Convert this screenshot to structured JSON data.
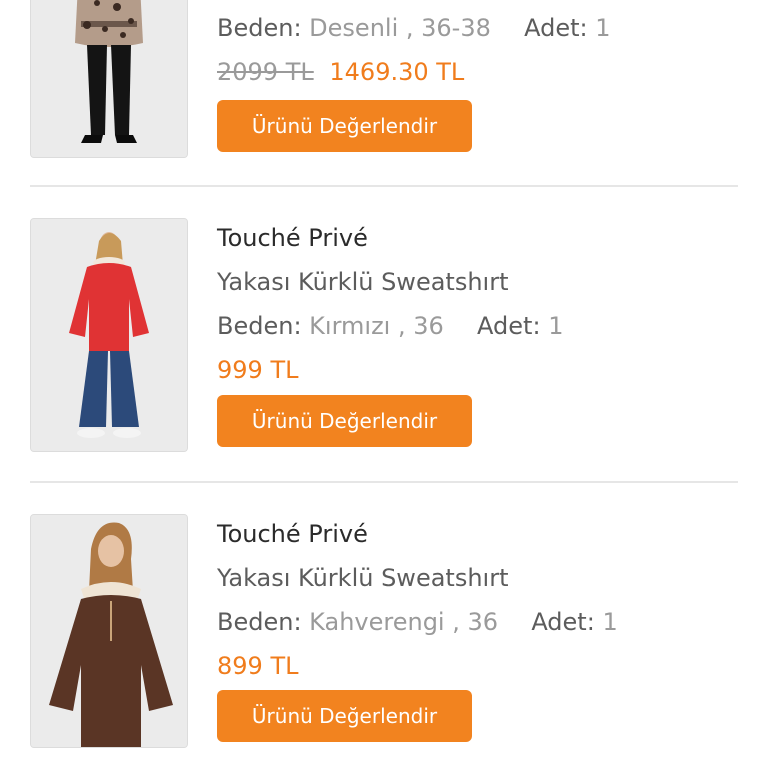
{
  "orders": [
    {
      "brand": "",
      "name": "",
      "size_label": "Beden:",
      "size_value": "Desenli , 36-38",
      "qty_label": "Adet:",
      "qty_value": "1",
      "old_price": "2099 TL",
      "price": "1469.30 TL",
      "button_label": "Ürünü Değerlendir",
      "image_icon": "product-photo-leopard-jacket"
    },
    {
      "brand": "Touché Privé",
      "name": "Yakası Kürklü Sweatshırt",
      "size_label": "Beden:",
      "size_value": "Kırmızı , 36",
      "qty_label": "Adet:",
      "qty_value": "1",
      "old_price": "",
      "price": "999 TL",
      "button_label": "Ürünü Değerlendir",
      "image_icon": "product-photo-red-sweatshirt"
    },
    {
      "brand": "Touché Privé",
      "name": "Yakası Kürklü Sweatshırt",
      "size_label": "Beden:",
      "size_value": "Kahverengi , 36",
      "qty_label": "Adet:",
      "qty_value": "1",
      "old_price": "",
      "price": "899 TL",
      "button_label": "Ürünü Değerlendir",
      "image_icon": "product-photo-brown-sweatshirt"
    }
  ],
  "colors": {
    "accent": "#f2831f",
    "price": "#f07c1c",
    "text_dark": "#2b2b2b",
    "text_muted": "#9a9a9a"
  }
}
